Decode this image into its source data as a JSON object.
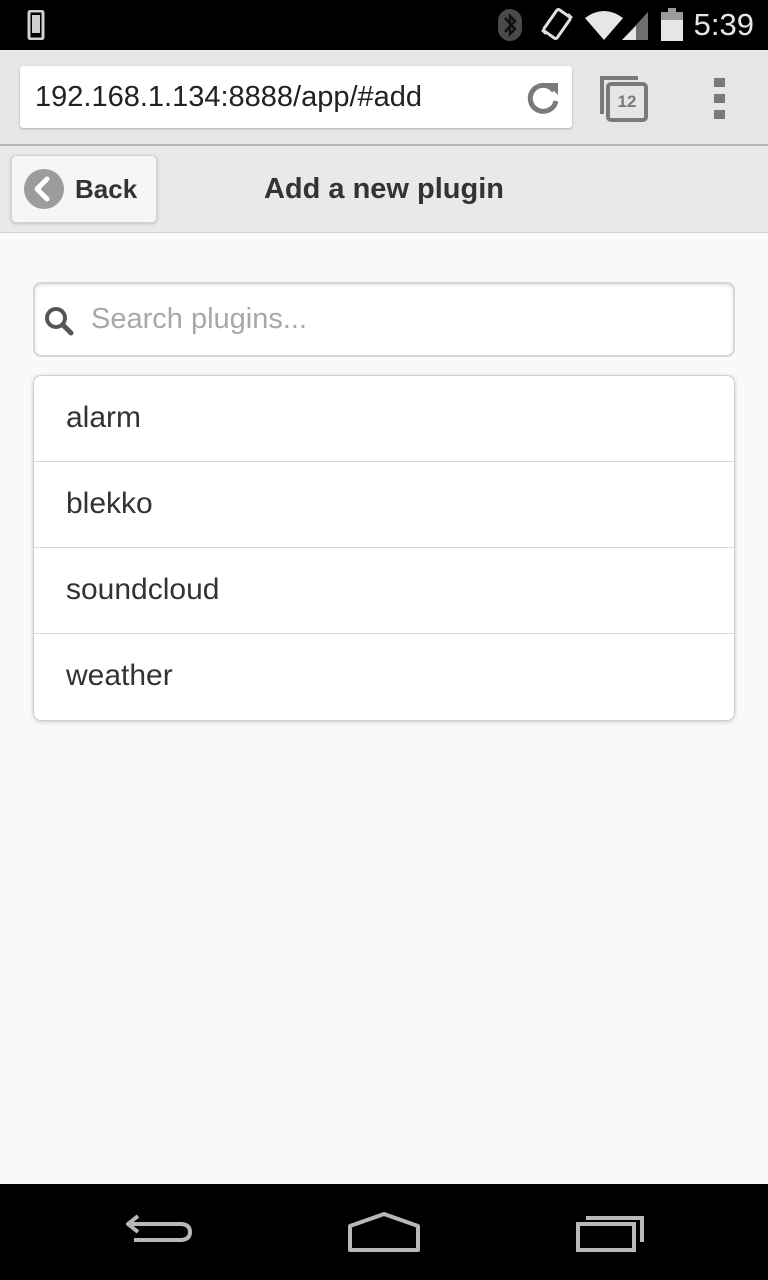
{
  "status_bar": {
    "time": "5:39",
    "icons": [
      "phone-icon",
      "bluetooth-icon",
      "vibrate-icon",
      "wifi-icon",
      "signal-icon",
      "battery-icon"
    ]
  },
  "browser": {
    "url": "192.168.1.134:8888/app/#add",
    "tab_count": "12",
    "icons": [
      "reload-icon",
      "tabs-icon",
      "overflow-menu-icon"
    ]
  },
  "header": {
    "back_label": "Back",
    "title": "Add a new plugin"
  },
  "search": {
    "placeholder": "Search plugins...",
    "value": ""
  },
  "plugins": [
    {
      "label": "alarm"
    },
    {
      "label": "blekko"
    },
    {
      "label": "soundcloud"
    },
    {
      "label": "weather"
    }
  ],
  "nav": {
    "icons": [
      "back-nav-icon",
      "home-nav-icon",
      "recents-nav-icon"
    ]
  },
  "colors": {
    "page_background": "#f9f9f9",
    "header_background": "#e9e9e9",
    "text": "#333333",
    "placeholder": "#a8a8a8"
  }
}
